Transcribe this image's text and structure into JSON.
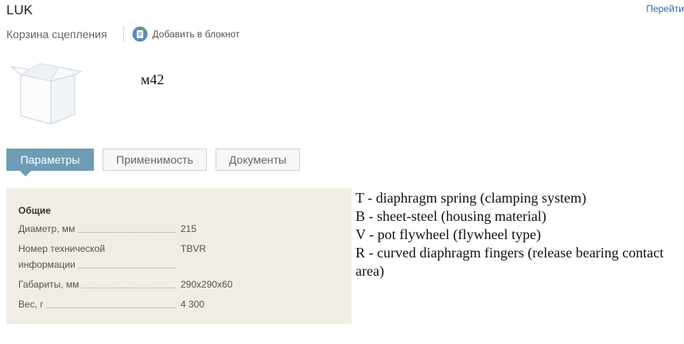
{
  "header": {
    "brand": "LUK",
    "goto_link": "Перейти"
  },
  "subheader": {
    "product_name": "Корзина сцепления",
    "notebook_label": "Добавить в блокнот"
  },
  "product": {
    "part_number": "м42"
  },
  "tabs": [
    {
      "label": "Параметры",
      "active": true
    },
    {
      "label": "Применимость",
      "active": false
    },
    {
      "label": "Документы",
      "active": false
    }
  ],
  "params": {
    "group_title": "Общие",
    "rows": [
      {
        "label": "Диаметр, мм",
        "value": "215"
      },
      {
        "label": "Номер технической информации",
        "label_line1": "Номер технической",
        "label_line2": "информации",
        "value": "TBVR"
      },
      {
        "label": "Габариты, мм",
        "value": "290x290x60"
      },
      {
        "label": "Вес, г",
        "value": "4 300"
      }
    ]
  },
  "notes": [
    "T - diaphragm spring (clamping system)",
    "B - sheet-steel (housing material)",
    "V - pot flywheel (flywheel type)",
    "R - curved diaphragm fingers (release bearing contact area)"
  ],
  "colors": {
    "active_tab": "#6e9cb6",
    "panel_bg": "#f1ede5",
    "link": "#2a6ab1",
    "notebook_icon": "#5a8fb0"
  },
  "icons": {
    "notebook": "notebook-add-icon",
    "product_image": "box-icon"
  }
}
